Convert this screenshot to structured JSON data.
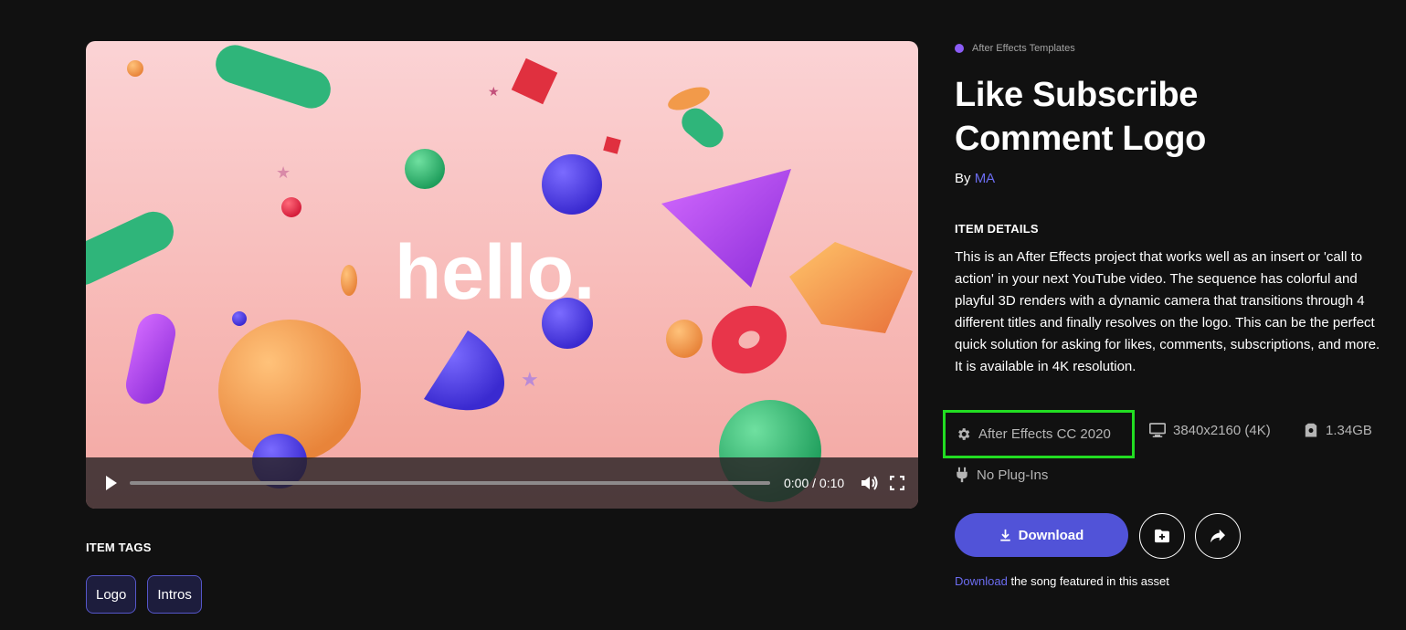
{
  "video": {
    "thumbnail_text": "hello.",
    "time_display": "0:00 / 0:10",
    "progress": 0
  },
  "tags_section": {
    "heading": "ITEM TAGS",
    "tags": [
      "Logo",
      "Intros"
    ]
  },
  "item": {
    "category": "After Effects Templates",
    "title": "Like Subscribe Comment Logo",
    "by_prefix": "By",
    "author": "MA",
    "details_heading": "ITEM DETAILS",
    "description": "This is an After Effects project that works well as an insert or 'call to action' in your next YouTube video. The sequence has colorful and playful 3D renders with a dynamic camera that transitions through 4 different titles and finally resolves on the logo. This can be the perfect quick solution for asking for likes, comments, subscriptions, and more. It is available in 4K resolution.",
    "specs": {
      "software": "After Effects CC 2020",
      "resolution": "3840x2160 (4K)",
      "file_size": "1.34GB",
      "plugins": "No Plug-Ins"
    },
    "download_label": "Download",
    "song_link": "Download",
    "song_text": " the song featured in this asset"
  },
  "colors": {
    "background": "#111111",
    "accent": "#5153d8",
    "link": "#6b6cf0",
    "category_dot": "#8b5cf6",
    "highlight_box": "#22dd22"
  },
  "icons": [
    "play-icon",
    "volume-icon",
    "fullscreen-icon",
    "gear-icon",
    "monitor-icon",
    "package-icon",
    "plug-icon",
    "download-icon",
    "folder-add-icon",
    "share-icon"
  ]
}
